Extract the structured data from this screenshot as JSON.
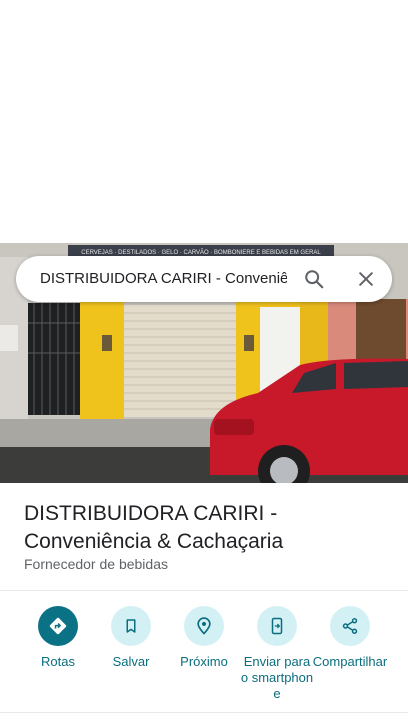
{
  "search": {
    "query": "DISTRIBUIDORA CARIRI - Conveniên",
    "search_icon": "search-icon",
    "close_icon": "close-icon"
  },
  "photo": {
    "sign_text": "CERVEJAS · DESTILADOS · GELO · CARVÃO · BOMBONIERE E BEBIDAS EM GERAL"
  },
  "place": {
    "name": "DISTRIBUIDORA CARIRI - Conveniência & Cachaçaria",
    "category": "Fornecedor de bebidas"
  },
  "actions": [
    {
      "label": "Rotas",
      "icon": "directions-icon"
    },
    {
      "label": "Salvar",
      "icon": "bookmark-icon"
    },
    {
      "label": "Próximo",
      "icon": "nearby-icon"
    },
    {
      "label": "Enviar para o smartphone",
      "icon": "send-to-phone-icon"
    },
    {
      "label": "Compartilhar",
      "icon": "share-icon"
    }
  ],
  "colors": {
    "accent": "#0b7285",
    "accent_light": "#d3f1f5",
    "label": "#0b6e7f"
  }
}
